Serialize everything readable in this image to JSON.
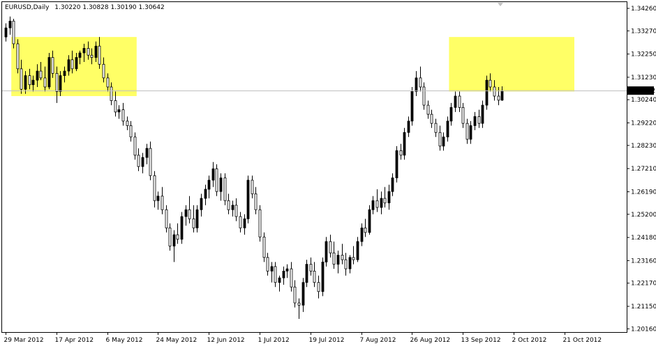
{
  "window": {
    "title_label": "EURUSD,Daily",
    "ohlc_readout": "1.30220 1.30828 1.30190 1.30642"
  },
  "current_price": {
    "value": 1.30642,
    "label": "1.30642"
  },
  "colors": {
    "background": "#ffffff",
    "frame": "#000000",
    "bull_body": "#000000",
    "bear_body": "#ffffff",
    "highlight_zone": "#ffff66",
    "price_line": "#c0c0c0"
  },
  "icons": [
    "scroll-marker-icon"
  ],
  "chart_data": {
    "type": "candlestick",
    "symbol": "EURUSD",
    "timeframe": "Daily",
    "ylim": [
      1.2017,
      1.3426
    ],
    "grid": false,
    "y_ticks": [
      "1.34260",
      "1.33270",
      "1.32250",
      "1.31230",
      "1.30240",
      "1.29220",
      "1.28230",
      "1.27210",
      "1.26190",
      "1.25200",
      "1.24180",
      "1.23160",
      "1.22170",
      "1.21150",
      "1.20160"
    ],
    "x_ticks": [
      {
        "label": "29 Mar 2012",
        "index": 0
      },
      {
        "label": "17 Apr 2012",
        "index": 13
      },
      {
        "label": "6 May 2012",
        "index": 26
      },
      {
        "label": "24 May 2012",
        "index": 39
      },
      {
        "label": "12 Jun 2012",
        "index": 52
      },
      {
        "label": "1 Jul 2012",
        "index": 65
      },
      {
        "label": "19 Jul 2012",
        "index": 78
      },
      {
        "label": "7 Aug 2012",
        "index": 91
      },
      {
        "label": "26 Aug 2012",
        "index": 104
      },
      {
        "label": "13 Sep 2012",
        "index": 117
      },
      {
        "label": "2 Oct 2012",
        "index": 130
      },
      {
        "label": "21 Oct 2012",
        "index": 143
      }
    ],
    "highlight_zones": [
      {
        "from_index": 2,
        "to_index": 33,
        "price_low": 1.304,
        "price_high": 1.33
      },
      {
        "from_index": 114,
        "to_index": 145,
        "price_low": 1.306,
        "price_high": 1.33
      }
    ],
    "ohlc": [
      [
        1.33,
        1.336,
        1.328,
        1.334
      ],
      [
        1.334,
        1.339,
        1.331,
        1.337
      ],
      [
        1.337,
        1.338,
        1.325,
        1.327
      ],
      [
        1.327,
        1.329,
        1.314,
        1.316
      ],
      [
        1.316,
        1.32,
        1.305,
        1.307
      ],
      [
        1.307,
        1.315,
        1.305,
        1.313
      ],
      [
        1.313,
        1.316,
        1.307,
        1.309
      ],
      [
        1.309,
        1.313,
        1.306,
        1.311
      ],
      [
        1.311,
        1.318,
        1.308,
        1.315
      ],
      [
        1.315,
        1.319,
        1.311,
        1.312
      ],
      [
        1.312,
        1.317,
        1.306,
        1.308
      ],
      [
        1.308,
        1.323,
        1.307,
        1.321
      ],
      [
        1.321,
        1.324,
        1.312,
        1.314
      ],
      [
        1.314,
        1.317,
        1.301,
        1.306
      ],
      [
        1.306,
        1.315,
        1.304,
        1.313
      ],
      [
        1.313,
        1.317,
        1.31,
        1.315
      ],
      [
        1.315,
        1.322,
        1.313,
        1.32
      ],
      [
        1.32,
        1.324,
        1.314,
        1.316
      ],
      [
        1.316,
        1.323,
        1.315,
        1.321
      ],
      [
        1.321,
        1.324,
        1.318,
        1.323
      ],
      [
        1.323,
        1.327,
        1.319,
        1.325
      ],
      [
        1.325,
        1.328,
        1.32,
        1.322
      ],
      [
        1.322,
        1.325,
        1.318,
        1.321
      ],
      [
        1.321,
        1.328,
        1.319,
        1.326
      ],
      [
        1.326,
        1.33,
        1.316,
        1.318
      ],
      [
        1.318,
        1.321,
        1.31,
        1.312
      ],
      [
        1.312,
        1.314,
        1.306,
        1.308
      ],
      [
        1.308,
        1.31,
        1.3,
        1.302
      ],
      [
        1.302,
        1.306,
        1.295,
        1.297
      ],
      [
        1.297,
        1.3,
        1.294,
        1.298
      ],
      [
        1.298,
        1.301,
        1.291,
        1.293
      ],
      [
        1.293,
        1.295,
        1.289,
        1.291
      ],
      [
        1.291,
        1.293,
        1.284,
        1.286
      ],
      [
        1.286,
        1.288,
        1.276,
        1.278
      ],
      [
        1.278,
        1.281,
        1.271,
        1.273
      ],
      [
        1.273,
        1.279,
        1.27,
        1.277
      ],
      [
        1.277,
        1.283,
        1.274,
        1.281
      ],
      [
        1.281,
        1.284,
        1.267,
        1.269
      ],
      [
        1.269,
        1.271,
        1.255,
        1.258
      ],
      [
        1.258,
        1.262,
        1.254,
        1.26
      ],
      [
        1.26,
        1.264,
        1.252,
        1.254
      ],
      [
        1.254,
        1.256,
        1.244,
        1.246
      ],
      [
        1.246,
        1.248,
        1.236,
        1.238
      ],
      [
        1.238,
        1.245,
        1.231,
        1.243
      ],
      [
        1.243,
        1.248,
        1.239,
        1.241
      ],
      [
        1.241,
        1.253,
        1.239,
        1.251
      ],
      [
        1.251,
        1.256,
        1.247,
        1.254
      ],
      [
        1.254,
        1.26,
        1.248,
        1.25
      ],
      [
        1.25,
        1.256,
        1.244,
        1.246
      ],
      [
        1.246,
        1.256,
        1.244,
        1.254
      ],
      [
        1.254,
        1.261,
        1.251,
        1.259
      ],
      [
        1.259,
        1.265,
        1.256,
        1.263
      ],
      [
        1.263,
        1.269,
        1.259,
        1.267
      ],
      [
        1.267,
        1.275,
        1.264,
        1.272
      ],
      [
        1.272,
        1.274,
        1.26,
        1.262
      ],
      [
        1.262,
        1.27,
        1.258,
        1.268
      ],
      [
        1.268,
        1.27,
        1.256,
        1.258
      ],
      [
        1.258,
        1.261,
        1.252,
        1.254
      ],
      [
        1.254,
        1.258,
        1.251,
        1.256
      ],
      [
        1.256,
        1.259,
        1.249,
        1.251
      ],
      [
        1.251,
        1.253,
        1.244,
        1.246
      ],
      [
        1.246,
        1.252,
        1.243,
        1.25
      ],
      [
        1.25,
        1.269,
        1.248,
        1.267
      ],
      [
        1.267,
        1.269,
        1.259,
        1.261
      ],
      [
        1.261,
        1.264,
        1.252,
        1.254
      ],
      [
        1.254,
        1.256,
        1.24,
        1.242
      ],
      [
        1.242,
        1.244,
        1.231,
        1.233
      ],
      [
        1.233,
        1.235,
        1.225,
        1.227
      ],
      [
        1.227,
        1.231,
        1.222,
        1.229
      ],
      [
        1.229,
        1.231,
        1.22,
        1.222
      ],
      [
        1.222,
        1.225,
        1.218,
        1.224
      ],
      [
        1.224,
        1.229,
        1.221,
        1.227
      ],
      [
        1.227,
        1.23,
        1.224,
        1.228
      ],
      [
        1.228,
        1.231,
        1.218,
        1.22
      ],
      [
        1.22,
        1.223,
        1.211,
        1.213
      ],
      [
        1.213,
        1.215,
        1.206,
        1.212
      ],
      [
        1.212,
        1.224,
        1.209,
        1.222
      ],
      [
        1.222,
        1.232,
        1.22,
        1.23
      ],
      [
        1.23,
        1.233,
        1.225,
        1.227
      ],
      [
        1.227,
        1.231,
        1.22,
        1.222
      ],
      [
        1.222,
        1.225,
        1.215,
        1.218
      ],
      [
        1.218,
        1.233,
        1.216,
        1.231
      ],
      [
        1.231,
        1.242,
        1.229,
        1.24
      ],
      [
        1.24,
        1.243,
        1.233,
        1.235
      ],
      [
        1.235,
        1.24,
        1.228,
        1.23
      ],
      [
        1.23,
        1.236,
        1.226,
        1.234
      ],
      [
        1.234,
        1.239,
        1.23,
        1.232
      ],
      [
        1.232,
        1.235,
        1.225,
        1.228
      ],
      [
        1.228,
        1.234,
        1.226,
        1.233
      ],
      [
        1.233,
        1.238,
        1.23,
        1.232
      ],
      [
        1.232,
        1.242,
        1.231,
        1.24
      ],
      [
        1.24,
        1.248,
        1.238,
        1.246
      ],
      [
        1.246,
        1.25,
        1.242,
        1.244
      ],
      [
        1.244,
        1.256,
        1.243,
        1.254
      ],
      [
        1.254,
        1.26,
        1.252,
        1.258
      ],
      [
        1.258,
        1.263,
        1.253,
        1.255
      ],
      [
        1.255,
        1.262,
        1.252,
        1.259
      ],
      [
        1.259,
        1.264,
        1.255,
        1.257
      ],
      [
        1.257,
        1.265,
        1.254,
        1.262
      ],
      [
        1.262,
        1.27,
        1.26,
        1.268
      ],
      [
        1.268,
        1.282,
        1.266,
        1.28
      ],
      [
        1.28,
        1.283,
        1.276,
        1.278
      ],
      [
        1.278,
        1.29,
        1.276,
        1.288
      ],
      [
        1.288,
        1.295,
        1.286,
        1.293
      ],
      [
        1.293,
        1.308,
        1.291,
        1.306
      ],
      [
        1.306,
        1.315,
        1.304,
        1.312
      ],
      [
        1.312,
        1.317,
        1.306,
        1.308
      ],
      [
        1.308,
        1.31,
        1.298,
        1.3
      ],
      [
        1.3,
        1.302,
        1.294,
        1.296
      ],
      [
        1.296,
        1.298,
        1.29,
        1.292
      ],
      [
        1.292,
        1.294,
        1.286,
        1.288
      ],
      [
        1.288,
        1.291,
        1.28,
        1.282
      ],
      [
        1.282,
        1.288,
        1.28,
        1.286
      ],
      [
        1.286,
        1.295,
        1.284,
        1.293
      ],
      [
        1.293,
        1.301,
        1.291,
        1.299
      ],
      [
        1.299,
        1.306,
        1.297,
        1.304
      ],
      [
        1.304,
        1.306,
        1.297,
        1.299
      ],
      [
        1.299,
        1.301,
        1.29,
        1.292
      ],
      [
        1.292,
        1.294,
        1.283,
        1.285
      ],
      [
        1.285,
        1.293,
        1.283,
        1.291
      ],
      [
        1.291,
        1.297,
        1.289,
        1.295
      ],
      [
        1.295,
        1.298,
        1.29,
        1.292
      ],
      [
        1.292,
        1.302,
        1.29,
        1.3
      ],
      [
        1.3,
        1.313,
        1.298,
        1.311
      ],
      [
        1.311,
        1.314,
        1.306,
        1.308
      ],
      [
        1.308,
        1.311,
        1.302,
        1.304
      ],
      [
        1.304,
        1.308,
        1.3,
        1.3022
      ],
      [
        1.3022,
        1.3083,
        1.3019,
        1.3064
      ]
    ]
  }
}
